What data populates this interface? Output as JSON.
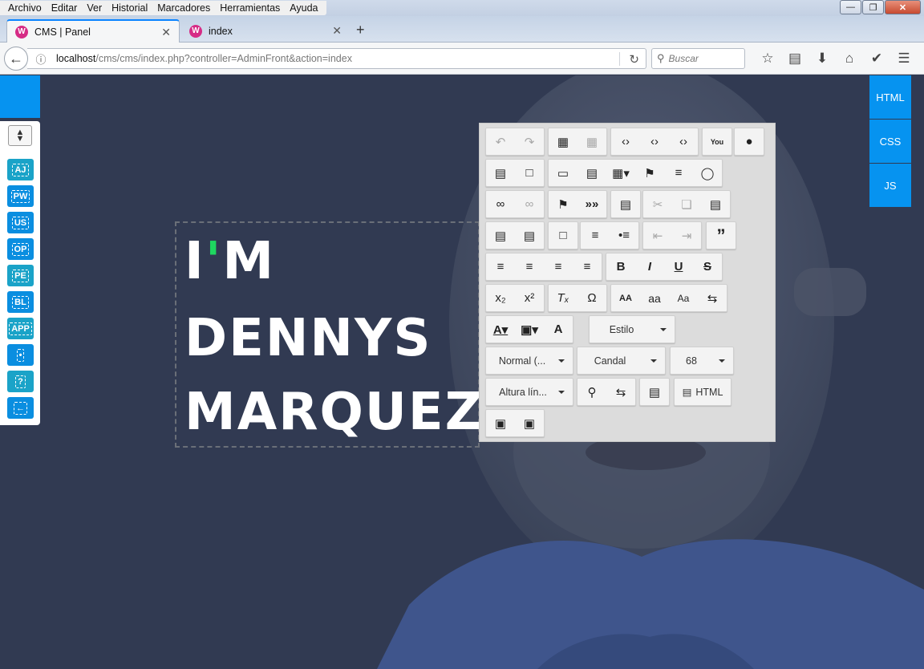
{
  "menu": [
    "Archivo",
    "Editar",
    "Ver",
    "Historial",
    "Marcadores",
    "Herramientas",
    "Ayuda"
  ],
  "tabs": [
    {
      "label": "CMS | Panel",
      "favicon": "W"
    },
    {
      "label": "index",
      "favicon": "W"
    }
  ],
  "new_tab": "+",
  "url": {
    "host": "localhost",
    "path": "/cms/cms/index.php?controller=AdminFront&action=index"
  },
  "search": {
    "placeholder": "Buscar"
  },
  "sidebar": {
    "items": [
      {
        "label": "AJ",
        "color": "#1aa3c8"
      },
      {
        "label": "PW",
        "color": "#0a8ee0"
      },
      {
        "label": "US",
        "color": "#0a8ee0"
      },
      {
        "label": "OP",
        "color": "#0a8ee0"
      },
      {
        "label": "PE",
        "color": "#1aa3c8"
      },
      {
        "label": "BL",
        "color": "#0a8ee0"
      },
      {
        "label": "APP",
        "color": "#1aa3c8"
      },
      {
        "label": "",
        "color": "#0a8ee0"
      },
      {
        "label": "?",
        "color": "#1aa3c8"
      },
      {
        "label": "",
        "color": "#0a8ee0"
      }
    ]
  },
  "right_buttons": [
    "HTML",
    "CSS",
    "JS"
  ],
  "headline": {
    "line1_a": "I",
    "line1_apos": "'",
    "line1_b": "M",
    "line2": "DENNYS",
    "line3": "MARQUEZ",
    "dot": "."
  },
  "editor": {
    "style_combo": "Estilo",
    "format_combo": "Normal (...",
    "font_combo": "Candal",
    "size_combo": "68",
    "lineheight_combo": "Altura lín...",
    "html_button": "HTML",
    "case_upper": "AA",
    "case_lower": "aa",
    "case_title": "Aa",
    "bold": "B",
    "italic": "I",
    "underline": "U",
    "strike": "S"
  },
  "colors": {
    "accent": "#0693f0",
    "green": "#1ed760",
    "page_bg": "#313a52"
  }
}
